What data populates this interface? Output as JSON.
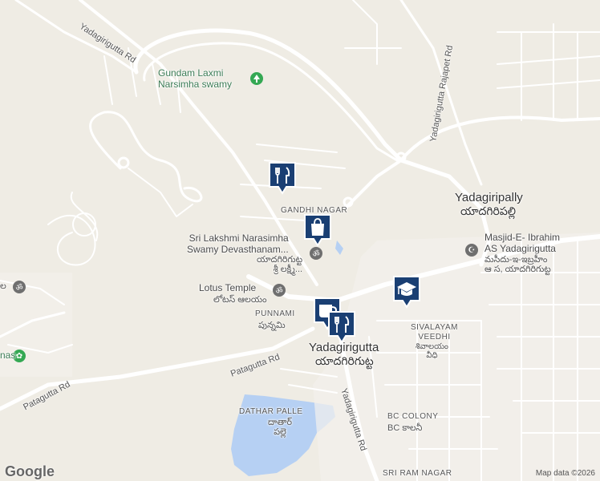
{
  "map": {
    "attribution": "Map data ©2026",
    "logo": "Google",
    "colors": {
      "land": "#efece4",
      "water": "#b6d0f3",
      "road": "#ffffff",
      "pin_bg": "#1a3f73"
    }
  },
  "labels": {
    "gundam": [
      "Gundam Laxmi",
      "Narsimha swamy"
    ],
    "gandhi_nagar": "GANDHI NAGAR",
    "temple": [
      "Sri Lakshmi Narasimha",
      "Swamy Devasthanam...",
      "యాదగిరిగుట్ట",
      "శ్రీ లక్ష్మీ..."
    ],
    "lotus": [
      "Lotus Temple",
      "లోటస్ ఆలయం"
    ],
    "punnami": [
      "PUNNAMI",
      "పున్నమి"
    ],
    "yadagirigutta": [
      "Yadagirigutta",
      "యాదగిరిగుట్ట"
    ],
    "yadagiripally": [
      "Yadagiripally",
      "యాదగిరిపల్లి"
    ],
    "masjid": [
      "Masjid-E- Ibrahim",
      "AS Yadagirigutta",
      "మసీదు-ఇ-ఇబ్రహీం",
      "ఆ స, యాదగిరిగుట్ట"
    ],
    "sivalayam": [
      "SIVALAYAM",
      "VEEDHI",
      "శివాలయం",
      "వీధి"
    ],
    "dathar": [
      "DATHAR PALLE",
      "దాతార్",
      "పల్లె"
    ],
    "bc_colony": [
      "BC COLONY",
      "BC కాలనీ"
    ],
    "sri_ram": "SRI RAM NAGAR",
    "left_edge": [
      "nas",
      "ల"
    ],
    "roads": {
      "yadagirigutta_rd_top": "Yadagirigutta Rd",
      "rajapet_rd": "Yadagirigutta Rajapet Rd",
      "patagutta_rd_mid": "Patagutta Rd",
      "patagutta_rd_left": "Patagutta Rd",
      "yadagirigutta_rd_bottom": "Yadagirigutta Rd"
    }
  },
  "icons": {
    "restaurant": "fork-knife-icon",
    "shopping": "shopping-bag-icon",
    "cafe": "coffee-cup-icon",
    "school": "graduation-cap-icon",
    "temple": "om-icon",
    "park": "tree-icon",
    "mosque": "mosque-icon"
  }
}
